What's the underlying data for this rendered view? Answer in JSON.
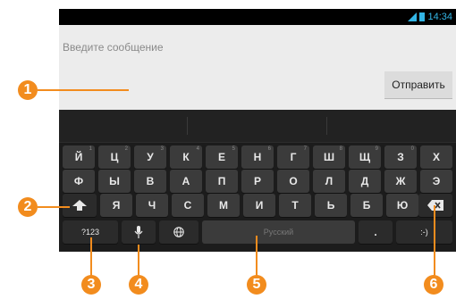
{
  "status_bar": {
    "time": "14:34",
    "signal_icon": "signal-icon",
    "battery_icon": "battery-icon",
    "accent": "#33b5e5"
  },
  "compose": {
    "placeholder": "Введите сообщение",
    "send_label": "Отправить"
  },
  "keyboard": {
    "row1": [
      "Й",
      "Ц",
      "У",
      "К",
      "Е",
      "Н",
      "Г",
      "Ш",
      "Щ",
      "З",
      "Х"
    ],
    "row1_hints": [
      "1",
      "2",
      "3",
      "4",
      "5",
      "6",
      "7",
      "8",
      "9",
      "0",
      ""
    ],
    "row2": [
      "Ф",
      "Ы",
      "В",
      "А",
      "П",
      "Р",
      "О",
      "Л",
      "Д",
      "Ж",
      "Э"
    ],
    "row3": [
      "Я",
      "Ч",
      "С",
      "М",
      "И",
      "Т",
      "Ь",
      "Б",
      "Ю"
    ],
    "symbols_label": "?123",
    "space_label": "Русский",
    "period_label": ".",
    "smiley_label": ":-)",
    "icons": {
      "shift": "shift-icon",
      "mic": "microphone-icon",
      "globe": "globe-icon",
      "backspace": "backspace-icon"
    }
  },
  "callouts": [
    "1",
    "2",
    "3",
    "4",
    "5",
    "6"
  ],
  "callout_color": "#f28c1e"
}
